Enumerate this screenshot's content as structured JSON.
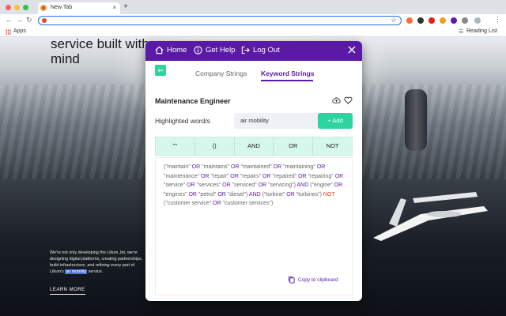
{
  "browser": {
    "tab_title": "New Tab",
    "tab_close": "×",
    "new_tab": "+",
    "bookmarks": {
      "apps_label": "Apps",
      "reading_list_label": "Reading List"
    }
  },
  "background_page": {
    "hero_lines": [
      "service built with",
      "mind"
    ],
    "body_text_before": "We're not only developing the Lilium Jet, we're designing digital platforms, creating partnerships, build infrastructure, and refining every part of Lilium's",
    "body_text_highlight": "air mobility",
    "body_text_after": "service.",
    "learn_more": "LEARN MORE"
  },
  "popup": {
    "header": {
      "home": "Home",
      "help": "Get Help",
      "logout": "Log Out"
    },
    "tabs": [
      {
        "label": "Company Strings",
        "active": false
      },
      {
        "label": "Keyword Strings",
        "active": true
      }
    ],
    "role_title": "Maintenance Engineer",
    "highlight": {
      "label": "Highlighted word/s",
      "value": "air mobility",
      "add_label": "+ Add"
    },
    "operators": [
      "\"\"",
      "()",
      "AND",
      "OR",
      "NOT"
    ],
    "query_tokens": [
      {
        "t": "(\"maintain\" ",
        "k": "term"
      },
      {
        "t": "OR",
        "k": "op"
      },
      {
        "t": " \"maintains\" ",
        "k": "term"
      },
      {
        "t": "OR",
        "k": "op"
      },
      {
        "t": " \"maintained\" ",
        "k": "term"
      },
      {
        "t": "OR",
        "k": "op"
      },
      {
        "t": " \"maintaining\" ",
        "k": "term"
      },
      {
        "t": "OR",
        "k": "op"
      },
      {
        "t": " \"maintenance\" ",
        "k": "term"
      },
      {
        "t": "OR",
        "k": "op"
      },
      {
        "t": " \"repair\" ",
        "k": "term"
      },
      {
        "t": "OR",
        "k": "op"
      },
      {
        "t": " \"repairs\" ",
        "k": "term"
      },
      {
        "t": "OR",
        "k": "op"
      },
      {
        "t": " \"repaired\" ",
        "k": "term"
      },
      {
        "t": "OR",
        "k": "op"
      },
      {
        "t": " \"repairing\" ",
        "k": "term"
      },
      {
        "t": "OR",
        "k": "op"
      },
      {
        "t": " \"service\" ",
        "k": "term"
      },
      {
        "t": "OR",
        "k": "op"
      },
      {
        "t": " \"services\" ",
        "k": "term"
      },
      {
        "t": "OR",
        "k": "op"
      },
      {
        "t": " \"serviced\" ",
        "k": "term"
      },
      {
        "t": "OR",
        "k": "op"
      },
      {
        "t": " \"servicing\") ",
        "k": "term"
      },
      {
        "t": "AND",
        "k": "op"
      },
      {
        "t": " (\"engine\" ",
        "k": "term"
      },
      {
        "t": "OR",
        "k": "op"
      },
      {
        "t": " \"engines\" ",
        "k": "term"
      },
      {
        "t": "OR",
        "k": "op"
      },
      {
        "t": " \"petrol\" ",
        "k": "term"
      },
      {
        "t": "OR",
        "k": "op"
      },
      {
        "t": " \"diesel\") ",
        "k": "term"
      },
      {
        "t": "AND",
        "k": "op"
      },
      {
        "t": " (\"turbine\" ",
        "k": "term"
      },
      {
        "t": "OR",
        "k": "op"
      },
      {
        "t": " \"turbines\") ",
        "k": "term"
      },
      {
        "t": "NOT",
        "k": "not"
      },
      {
        "t": " (\"customer service\" ",
        "k": "term"
      },
      {
        "t": "OR",
        "k": "op"
      },
      {
        "t": " \"customer services\")",
        "k": "term"
      }
    ],
    "copy_label": "Copy to clipboard"
  },
  "colors": {
    "brand_purple": "#5b1aa6",
    "accent_green": "#2ed3a0",
    "not_orange": "#e8481c"
  }
}
